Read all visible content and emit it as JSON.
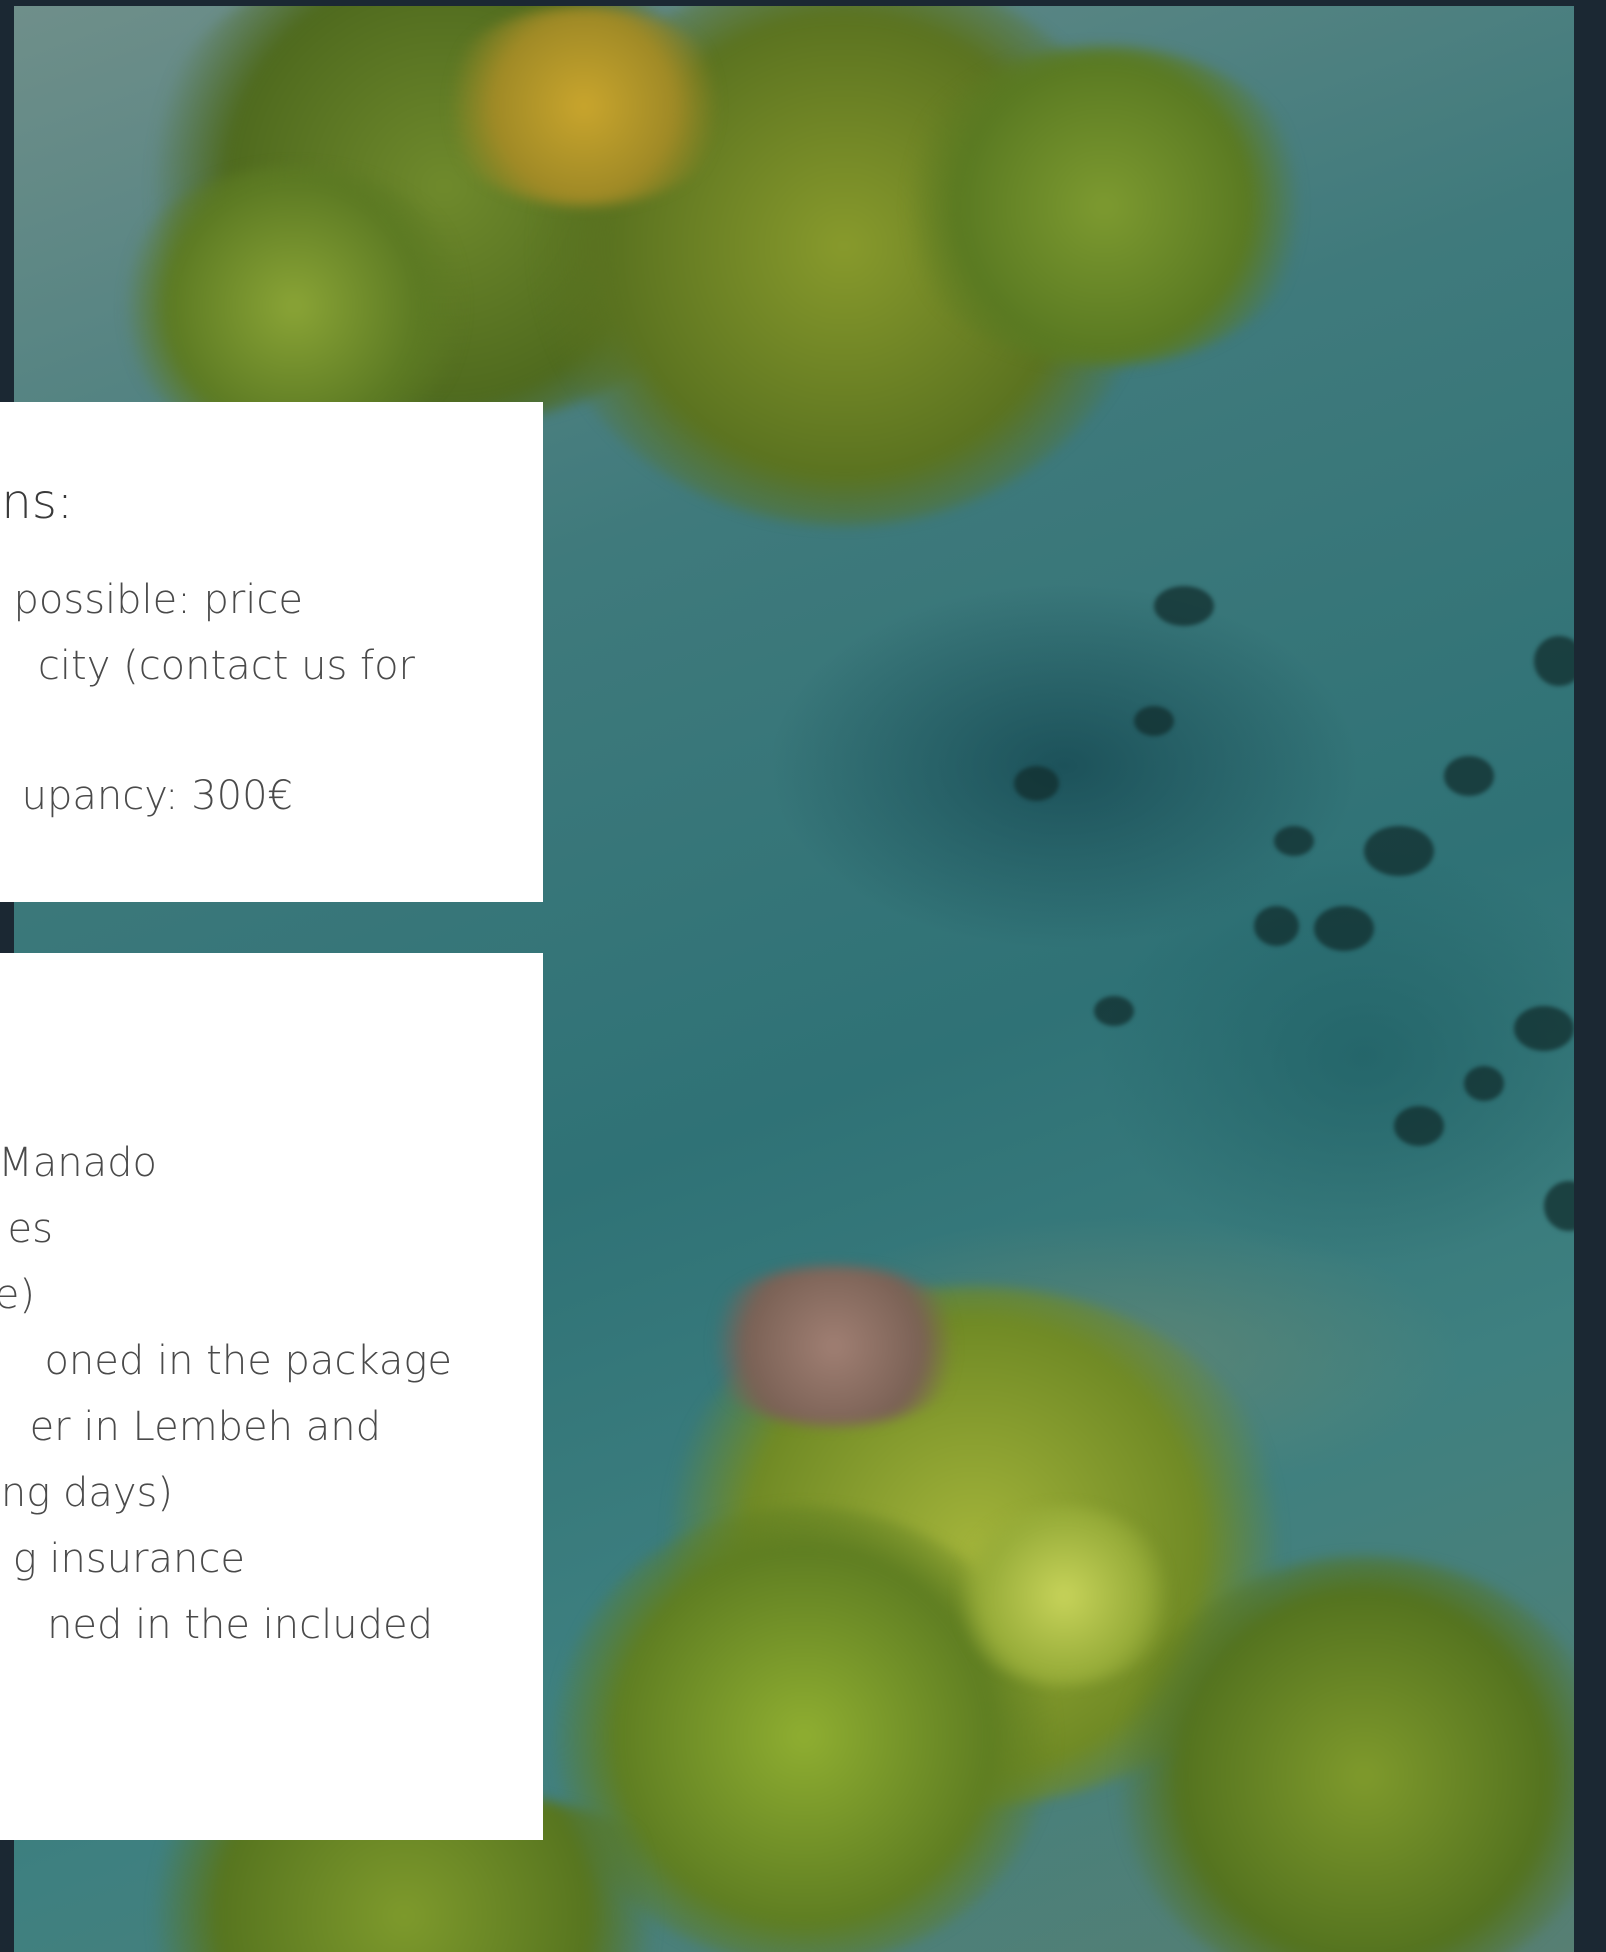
{
  "options_section": {
    "heading": "ns:",
    "lines": [
      "possible: price",
      "city (contact us for",
      "upancy: 300€"
    ]
  },
  "includes_section": {
    "lines": [
      "Manado",
      "es",
      "e)",
      "oned in the package",
      "er in Lembeh and",
      "ng days)",
      "g insurance",
      "ned in the included"
    ]
  },
  "colors": {
    "page_background": "#1b2833",
    "card_background": "#ffffff",
    "text": "#4a4a4a"
  }
}
